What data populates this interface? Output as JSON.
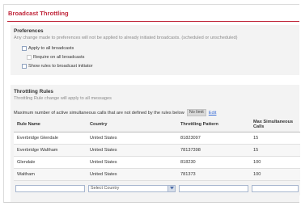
{
  "page": {
    "title": "Broadcast Throttling"
  },
  "preferences": {
    "title": "Preferences",
    "description": "Any change made to preferences will not be applied to already initiated broadcasts. (scheduled or unscheduled)",
    "apply_all_label": "Apply to all broadcasts",
    "require_all_label": "Require on all broadcasts",
    "show_rules_label": "Show rules to broadcast initiator"
  },
  "rules": {
    "title": "Throttling Rules",
    "description": "Throttling Rule change will apply to all messages",
    "max_label": "Maximum number of active simultaneous calls that are not defined by the rules below",
    "max_value": "No limit",
    "edit_label": "Edit",
    "columns": [
      "Rule Name",
      "Country",
      "Throttling Pattern",
      "Max Simultaneous Calls"
    ],
    "rows": [
      [
        "Everbridge Glendale",
        "United States",
        "81823097",
        "15"
      ],
      [
        "Everbridge Waltham",
        "United States",
        "78137398",
        "15"
      ],
      [
        "Glendale",
        "United States",
        "818230",
        "100"
      ],
      [
        "Waltham",
        "United States",
        "781373",
        "100"
      ]
    ],
    "country_select_value": "Select Country"
  },
  "colors": {
    "accent": "#c0263a",
    "link": "#3a6fd8"
  }
}
